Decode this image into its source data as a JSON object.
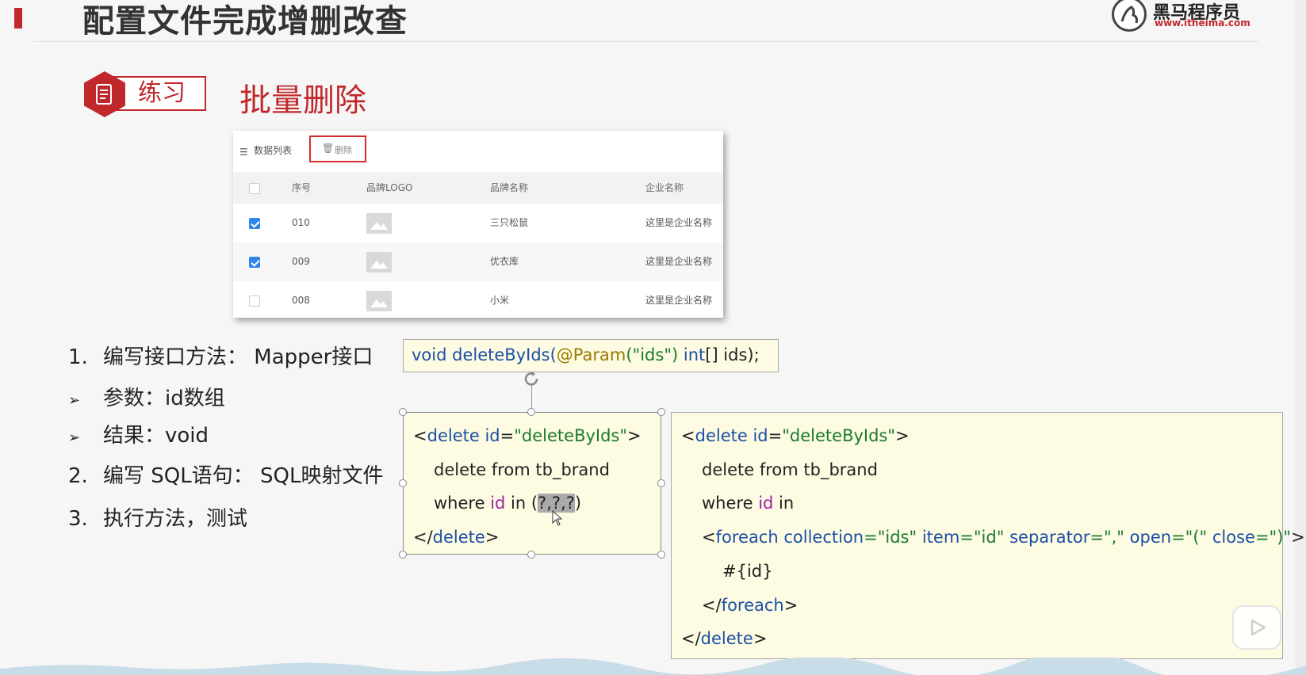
{
  "slide": {
    "title": "配置文件完成增删改查",
    "logo": {
      "name": "黑马程序员",
      "url": "www.itheima.com"
    },
    "practice_label": "练习",
    "subtitle": "批量删除"
  },
  "table_widget": {
    "toolbar_title": "数据列表",
    "delete_label": "删除",
    "columns": [
      "序号",
      "品牌LOGO",
      "品牌名称",
      "企业名称"
    ],
    "rows": [
      {
        "checked": true,
        "no": "010",
        "name": "三只松鼠",
        "company": "这里是企业名称"
      },
      {
        "checked": true,
        "no": "009",
        "name": "优衣库",
        "company": "这里是企业名称"
      },
      {
        "checked": false,
        "no": "008",
        "name": "小米",
        "company": "这里是企业名称"
      }
    ]
  },
  "steps": [
    {
      "marker": "1.",
      "text": "编写接口方法： Mapper接口"
    },
    {
      "marker": "➢",
      "text": "参数：id数组"
    },
    {
      "marker": "➢",
      "text": "结果：void"
    },
    {
      "marker": "2.",
      "text": "编写 SQL语句： SQL映射文件"
    },
    {
      "marker": "3.",
      "text": "执行方法，测试"
    }
  ],
  "code": {
    "signature": {
      "kw_void": "void",
      "method": "deleteByIds(",
      "annotation": "@Param",
      "arg": "(\"ids\")",
      "kw_int": "int",
      "rest": "[] ids);"
    },
    "sql_simple": {
      "open_lt": "<",
      "open_tag": "delete",
      "open_attr": "id",
      "open_eq": "=",
      "open_val": "\"deleteByIds\"",
      "open_gt": ">",
      "line2": "delete from tb_brand",
      "where": "where ",
      "id": "id",
      "in": " in (",
      "placeholders": "?,?,?",
      "close_paren": ")",
      "close_lt": "</",
      "close_tag": "delete",
      "close_gt": ">"
    },
    "sql_foreach": {
      "open_lt": "<",
      "open_tag": "delete",
      "open_attr": "id",
      "open_eq": "=",
      "open_val": "\"deleteByIds\"",
      "open_gt": ">",
      "line2": "delete from tb_brand",
      "where": "where ",
      "id": "id",
      "in": " in",
      "fe_lt": "<",
      "fe_tag": "foreach",
      "fe_attr1": "collection",
      "fe_val1": "=\"ids\"",
      "fe_attr2": "item",
      "fe_val2": "=\"id\"",
      "fe_attr3": "separator",
      "fe_val3": "=\",\"",
      "fe_attr4": "open",
      "fe_val4": "=\"(\"",
      "fe_attr5": "close",
      "fe_val5": "=\")\"",
      "fe_gt": ">",
      "body": "#{id}",
      "fe_close_lt": "</",
      "fe_close_tag": "foreach",
      "fe_close_gt": ">",
      "close_lt": "</",
      "close_tag": "delete",
      "close_gt": ">"
    }
  },
  "colors": {
    "brand_red": "#c0282b",
    "code_bg": "#fdfbe2",
    "keyword_blue": "#1c4fa6",
    "string_green": "#1a7a2e",
    "attr_purple": "#9b22a3",
    "checkbox_blue": "#2f86e6"
  },
  "icons": [
    "logo-emblem-icon",
    "document-icon",
    "list-icon",
    "trash-icon",
    "image-placeholder-icon",
    "rotate-handle-icon",
    "mouse-cursor-icon",
    "play-icon"
  ]
}
